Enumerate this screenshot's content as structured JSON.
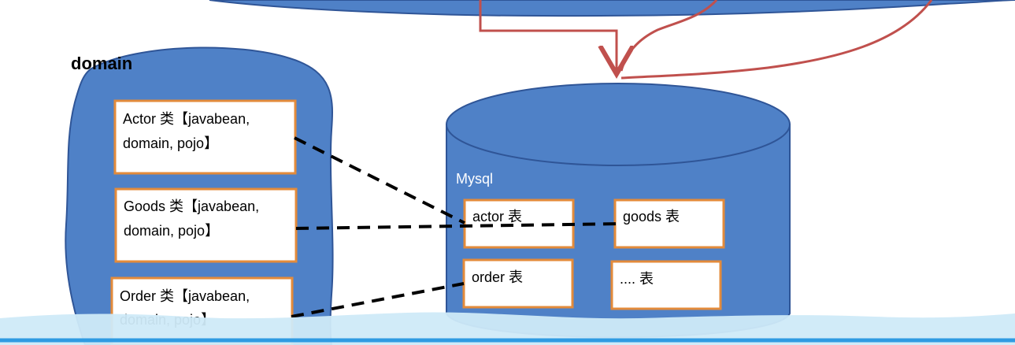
{
  "domain_group": {
    "title": "domain",
    "classes": [
      {
        "line1": "Actor 类【javabean,",
        "line2": "domain, pojo】"
      },
      {
        "line1": "Goods 类【javabean,",
        "line2": "domain, pojo】"
      },
      {
        "line1": "Order 类【javabean,",
        "line2": "domain, pojo】"
      }
    ]
  },
  "database": {
    "name": "Mysql",
    "tables": [
      {
        "label": "actor 表"
      },
      {
        "label": "goods 表"
      },
      {
        "label": "order 表"
      },
      {
        "label": ".... 表"
      }
    ]
  },
  "colors": {
    "blue_fill": "#4f81c7",
    "blue_stroke": "#2f5597",
    "box_border": "#e38b3b",
    "arrow": "#c0504d",
    "dashed_line": "#000000",
    "bottom_band": "#cfeaf8",
    "bottom_band_line": "#2f9be2"
  }
}
